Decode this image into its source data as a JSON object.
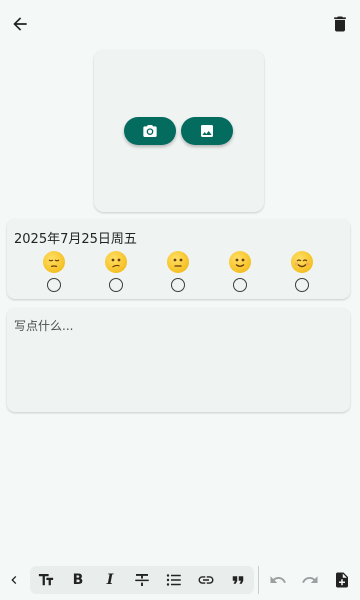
{
  "header": {
    "back_icon": "arrow-back-icon",
    "delete_icon": "delete-icon"
  },
  "photo": {
    "camera_icon": "camera-icon",
    "gallery_icon": "image-icon",
    "accent": "#046b5f"
  },
  "mood": {
    "date": "2025年7月25日周五",
    "options": [
      {
        "icon": "pensive-face-icon"
      },
      {
        "icon": "confused-face-icon"
      },
      {
        "icon": "neutral-face-icon"
      },
      {
        "icon": "slight-smile-icon"
      },
      {
        "icon": "smiling-face-icon"
      }
    ]
  },
  "note": {
    "placeholder": "写点什么...",
    "value": ""
  },
  "toolbar": {
    "items": [
      "collapse-chevron-icon",
      "text-size-icon",
      "bold-icon",
      "italic-icon",
      "strikethrough-icon",
      "bullet-list-icon",
      "link-icon",
      "quote-icon",
      "undo-icon",
      "redo-icon",
      "add-note-icon"
    ],
    "bold_glyph": "B",
    "italic_glyph": "I"
  }
}
